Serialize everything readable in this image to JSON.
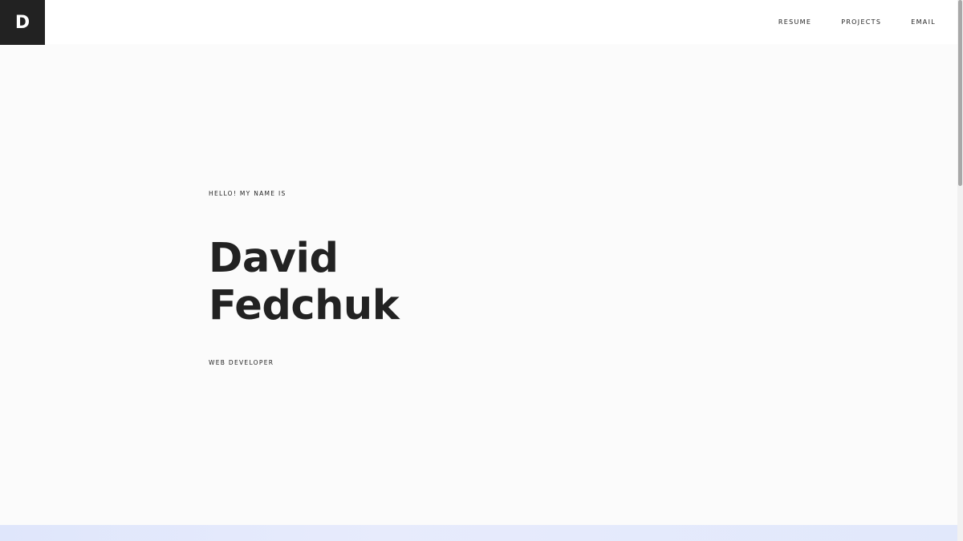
{
  "header": {
    "logo_letter": "D",
    "nav": [
      {
        "label": "RESUME"
      },
      {
        "label": "PROJECTS"
      },
      {
        "label": "EMAIL"
      }
    ]
  },
  "hero": {
    "greeting": "HELLO! MY NAME IS",
    "first_name": "David",
    "last_name": "Fedchuk",
    "role": "WEB DEVELOPER"
  },
  "colors": {
    "text": "#222222",
    "background": "#fbfbfb",
    "accent_band": "#e1e8fb"
  }
}
